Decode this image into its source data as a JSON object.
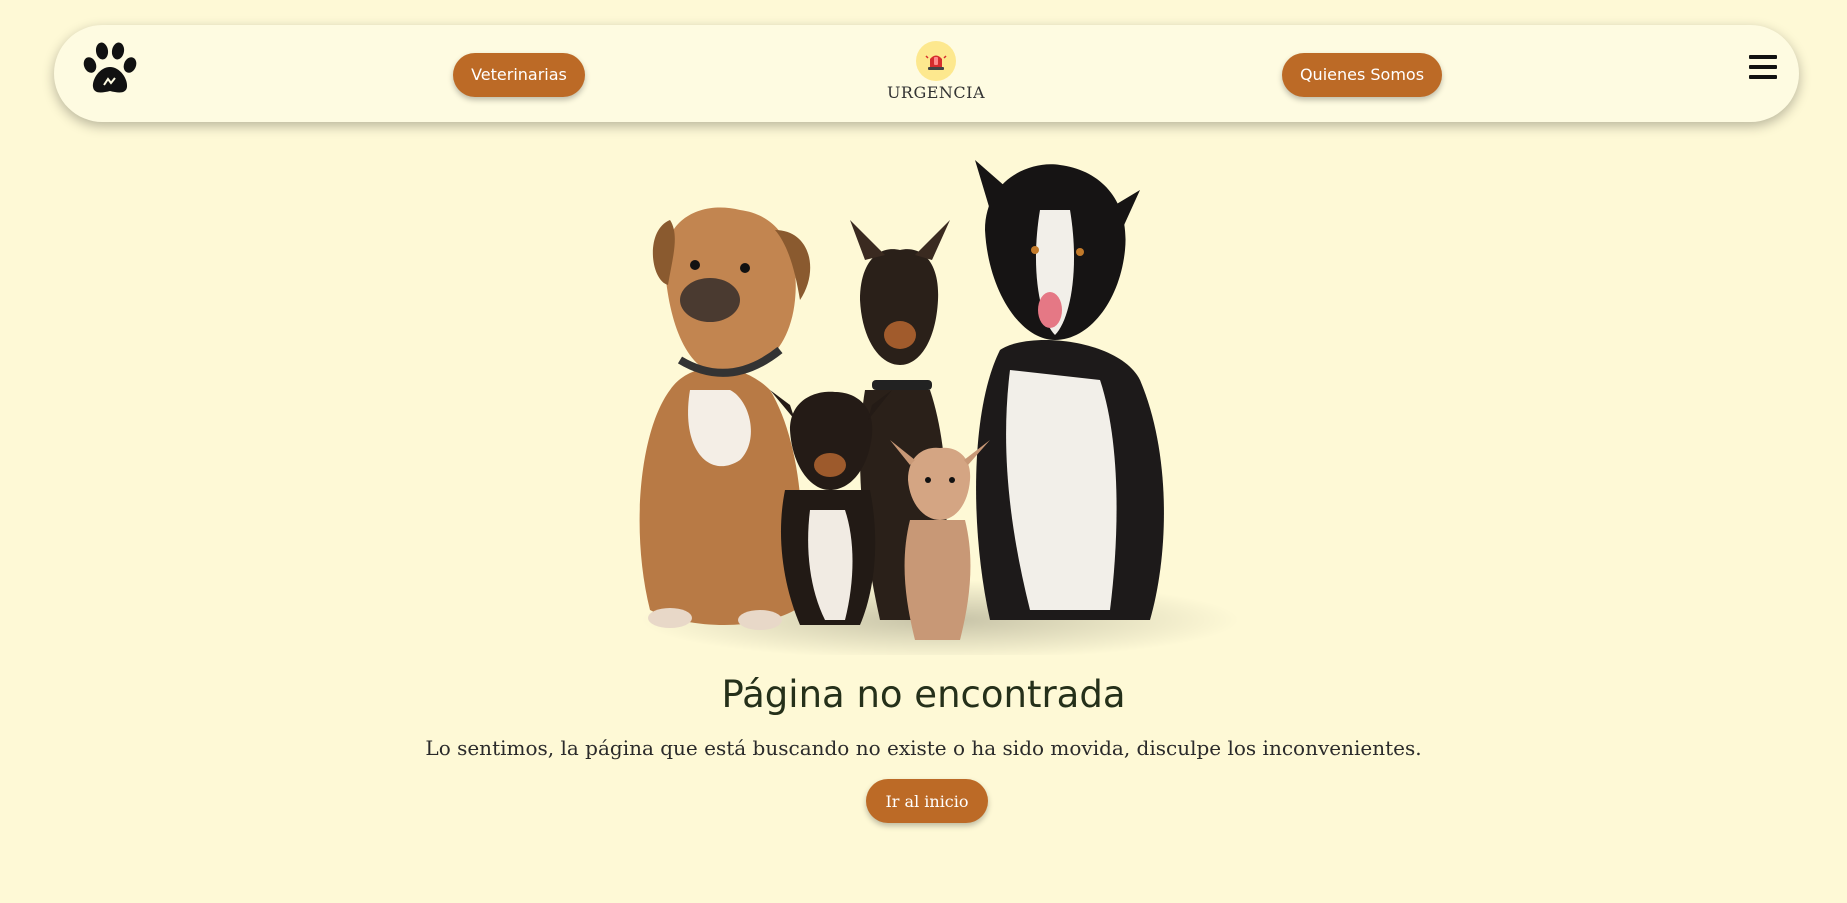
{
  "navbar": {
    "logo_icon": "paw-icon",
    "veterinarias_label": "Veterinarias",
    "urgencia_icon": "siren-icon",
    "urgencia_label": "URGENCIA",
    "quienes_label": "Quienes Somos",
    "menu_icon": "hamburger-menu-icon"
  },
  "main": {
    "image_alt": "Grupo de perros",
    "title": "Página no encontrada",
    "message": "Lo sentimos, la página que está buscando no existe o ha sido movida, disculpe los inconvenientes.",
    "home_button_label": "Ir al inicio"
  },
  "colors": {
    "background": "#fef9d6",
    "navbar_bg": "#fefbe1",
    "button_bg": "#bc6a26",
    "urgencia_circle": "#fde88e",
    "title_text": "#25301a"
  }
}
